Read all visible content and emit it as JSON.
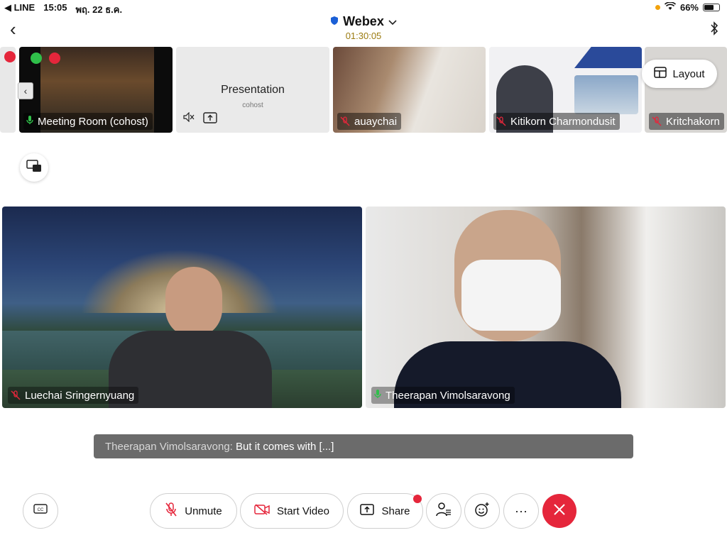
{
  "status_bar": {
    "carrier": "◀ LINE",
    "time": "15:05",
    "date": "พฤ. 22 ธ.ค.",
    "battery": "66%",
    "battery_level": 0.66
  },
  "header": {
    "title": "Webex",
    "timer": "01:30:05"
  },
  "strip": {
    "tiles": [
      {
        "name": "Meeting Room (cohost)"
      },
      {
        "name": "Presentation",
        "sub": "cohost"
      },
      {
        "name": "auaychai"
      },
      {
        "name": "Kitikorn Charmondusit"
      },
      {
        "name": "Kritchakorn"
      }
    ],
    "layout_label": "Layout"
  },
  "main": {
    "left_name": "Luechai Sringernyuang",
    "right_name": "Theerapan Vimolsaravong"
  },
  "caption": {
    "speaker": "Theerapan Vimolsaravong:",
    "text": " But it comes with [...]"
  },
  "controls": {
    "unmute": "Unmute",
    "start_video": "Start Video",
    "share": "Share",
    "more": "···"
  },
  "colors": {
    "leave": "#e5263b",
    "mic_off": "#e5263b",
    "mic_on": "#2fbf4a"
  }
}
